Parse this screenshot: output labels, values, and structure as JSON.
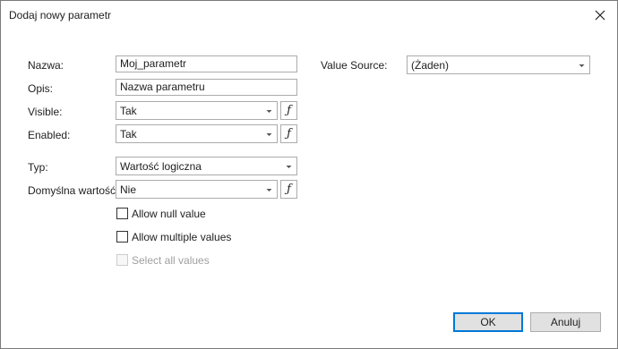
{
  "dialog": {
    "title": "Dodaj nowy parametr",
    "close_icon": "close-icon"
  },
  "form": {
    "name_label": "Nazwa:",
    "name_value": "Moj_parametr",
    "description_label": "Opis:",
    "description_value": "Nazwa parametru",
    "visible_label": "Visible:",
    "visible_value": "Tak",
    "enabled_label": "Enabled:",
    "enabled_value": "Tak",
    "type_label": "Typ:",
    "type_value": "Wartość logiczna",
    "default_label": "Domyślna wartość:",
    "default_value": "Nie",
    "fx_symbol": "ƒ",
    "value_source_label": "Value Source:",
    "value_source_value": "(Żaden)"
  },
  "options": {
    "allow_null": {
      "label": "Allow null value",
      "checked": false,
      "enabled": true
    },
    "allow_multiple": {
      "label": "Allow multiple values",
      "checked": false,
      "enabled": true
    },
    "select_all": {
      "label": "Select all values",
      "checked": false,
      "enabled": false
    }
  },
  "buttons": {
    "ok_label": "OK",
    "cancel_label": "Anuluj"
  }
}
